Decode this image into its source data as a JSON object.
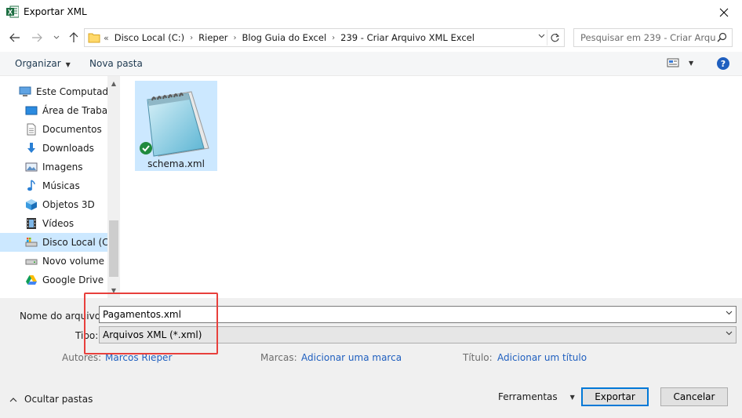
{
  "window": {
    "title": "Exportar XML",
    "app_icon_letter": "X"
  },
  "address": {
    "lead": "«",
    "crumbs": [
      "Disco Local (C:)",
      "Rieper",
      "Blog Guia do Excel",
      "239 - Criar Arquivo XML Excel"
    ],
    "search_placeholder": "Pesquisar em 239 - Criar Arqu..."
  },
  "toolbar": {
    "organize": "Organizar",
    "new_folder": "Nova pasta",
    "help": "?"
  },
  "sidebar": {
    "items": [
      {
        "label": "Este Computador",
        "icon": "computer-icon"
      },
      {
        "label": "Área de Trabalho",
        "icon": "desktop-icon"
      },
      {
        "label": "Documentos",
        "icon": "documents-icon"
      },
      {
        "label": "Downloads",
        "icon": "downloads-icon"
      },
      {
        "label": "Imagens",
        "icon": "pictures-icon"
      },
      {
        "label": "Músicas",
        "icon": "music-icon"
      },
      {
        "label": "Objetos 3D",
        "icon": "objects-3d-icon"
      },
      {
        "label": "Vídeos",
        "icon": "videos-icon"
      },
      {
        "label": "Disco Local (C:)",
        "icon": "local-disk-icon"
      },
      {
        "label": "Novo volume (E",
        "icon": "drive-icon"
      },
      {
        "label": "Google Drive (G",
        "icon": "google-drive-icon"
      }
    ]
  },
  "files": [
    {
      "name": "schema.xml",
      "icon": "notepad-file-icon"
    }
  ],
  "form": {
    "filename_label": "Nome do arquivo:",
    "filename_value": "Pagamentos.xml",
    "type_label": "Tipo:",
    "type_value": "Arquivos XML (*.xml)",
    "authors_label": "Autores:",
    "authors_value": "Marcos Rieper",
    "tags_label": "Marcas:",
    "tags_value": "Adicionar uma marca",
    "title_label": "Título:",
    "title_value": "Adicionar um título"
  },
  "footer": {
    "hide_folders": "Ocultar pastas",
    "tools": "Ferramentas",
    "export": "Exportar",
    "cancel": "Cancelar"
  },
  "colors": {
    "selection": "#cce8ff",
    "link": "#1f5fbf",
    "highlight": "#e8403c",
    "excel_green": "#1d6f42"
  }
}
